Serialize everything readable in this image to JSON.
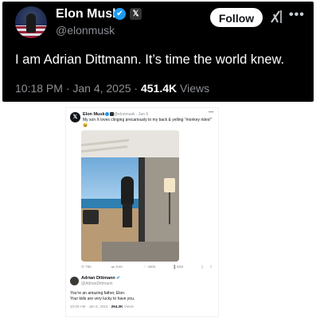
{
  "post": {
    "author_name": "Elon Musk",
    "handle": "@elonmusk",
    "follow_label": "Follow",
    "more_label": "•••",
    "x_badge": "𝕏",
    "verified_mark": "✔",
    "text": "I am Adrian Dittmann. It’s time the world knew.",
    "time": "10:18 PM · Jan 4, 2025 · ",
    "views_count": "451.4K",
    "views_label": " Views"
  },
  "embedded": {
    "author_name": "Elon Musk",
    "handle_date": "@elonmusk · Jan 6",
    "more_label": "•••",
    "avatar_glyph": "𝕏",
    "text": "My son X loves clinging precariously to my back & yelling “monkey rides!”",
    "emoji": "😆",
    "actions": {
      "replies": "78K",
      "reposts": "3mK",
      "likes": "480K",
      "views": "33M"
    },
    "reply": {
      "author_name": "Adrian Dittmann",
      "badge": "✔",
      "handle": "@AdrianDittmann",
      "line1": "You’re an amazing father, Elon.",
      "line2": "Your kids are very lucky to have you.",
      "time": "10:05 AM · Jan 6, 2024 · ",
      "views_count": "294.3K",
      "views_label": " Views"
    }
  },
  "icons": {
    "reply": "⬭",
    "repost": "⇄",
    "like": "♡",
    "views": "▐",
    "bookmark": "▯",
    "share": "⇧"
  },
  "colors": {
    "verified": "#1d9bf0",
    "dark_bg": "#000000",
    "muted": "#8b8f94"
  }
}
